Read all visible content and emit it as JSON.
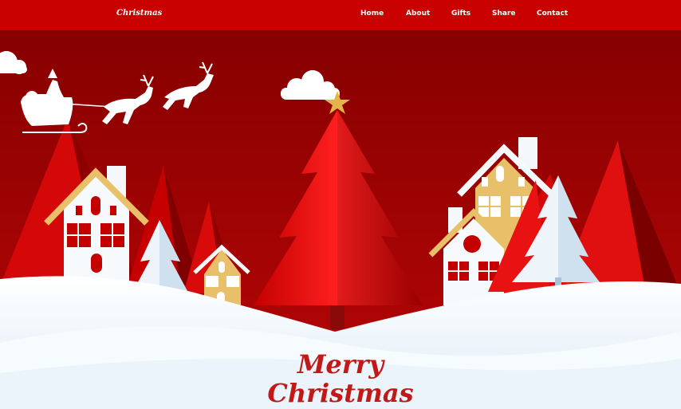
{
  "nav": {
    "brand": "Christmas",
    "links": [
      "Home",
      "About",
      "Gifts",
      "Share",
      "Contact"
    ]
  },
  "hero": {
    "title_line1": "Merry",
    "title_line2": "Christmas"
  },
  "colors": {
    "nav_bg": "#c80000",
    "sky": "#8a0000",
    "tree_red": "#e51010",
    "snow": "#f4f9fc",
    "house_gold": "#e9c06a",
    "title_red": "#c21818"
  }
}
